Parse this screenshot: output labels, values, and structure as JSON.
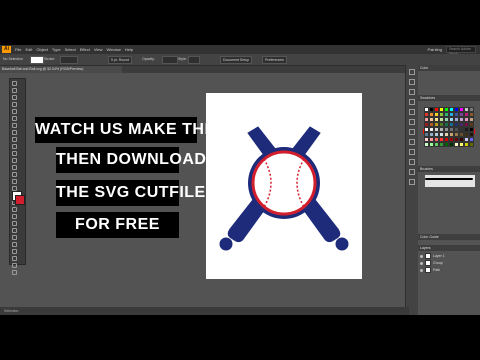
{
  "app": {
    "logo": "Ai",
    "menus": [
      "File",
      "Edit",
      "Object",
      "Type",
      "Select",
      "Effect",
      "View",
      "Window",
      "Help"
    ],
    "workspace": "Painting",
    "search_placeholder": "Search Adobe Stock"
  },
  "control_bar": {
    "selection": "No Selection",
    "stroke_label": "Stroke:",
    "brush": "5 pt. Round",
    "opacity_label": "Opacity:",
    "style_label": "Style:",
    "doc_setup": "Document Setup",
    "preferences": "Preferences"
  },
  "document_tab": "Baseball Bat and Ball.svg @ 52.04% (RGB/Preview)",
  "panels": {
    "color_title": "Color",
    "swatches_title": "Swatches",
    "brushes_title": "Brushes",
    "color_guide_title": "Color Guide",
    "layers_title": "Layers"
  },
  "layers": [
    "Layer 1",
    "Group",
    "Path"
  ],
  "status": "Selection",
  "caption": {
    "line1": "WATCH US MAKE THIS",
    "line2": "THEN DOWNLOAD",
    "line3": "THE SVG CUTFILE",
    "line4": "FOR FREE"
  },
  "colors": {
    "bat_navy": "#1e2a7a",
    "ball_red": "#d31f2d",
    "ui_dark": "#535353"
  }
}
